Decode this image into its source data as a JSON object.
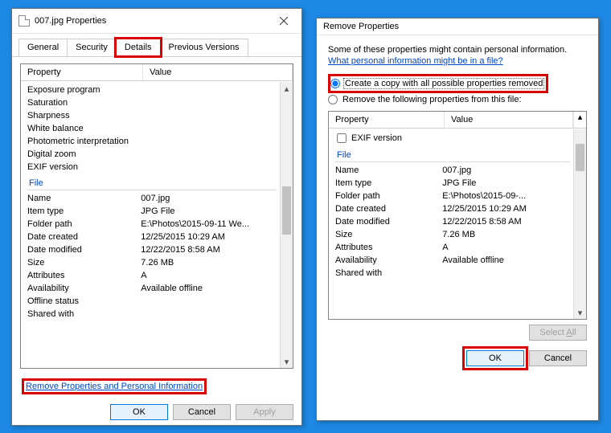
{
  "left": {
    "title": "007.jpg Properties",
    "tabs": [
      "General",
      "Security",
      "Details",
      "Previous Versions"
    ],
    "activeTab": 2,
    "columns": {
      "property": "Property",
      "value": "Value"
    },
    "groupA": [
      {
        "p": "Exposure program",
        "v": ""
      },
      {
        "p": "Saturation",
        "v": ""
      },
      {
        "p": "Sharpness",
        "v": ""
      },
      {
        "p": "White balance",
        "v": ""
      },
      {
        "p": "Photometric interpretation",
        "v": ""
      },
      {
        "p": "Digital zoom",
        "v": ""
      },
      {
        "p": "EXIF version",
        "v": ""
      }
    ],
    "fileSection": "File",
    "groupB": [
      {
        "p": "Name",
        "v": "007.jpg"
      },
      {
        "p": "Item type",
        "v": "JPG File"
      },
      {
        "p": "Folder path",
        "v": "E:\\Photos\\2015-09-11 We..."
      },
      {
        "p": "Date created",
        "v": "12/25/2015 10:29 AM"
      },
      {
        "p": "Date modified",
        "v": "12/22/2015 8:58 AM"
      },
      {
        "p": "Size",
        "v": "7.26 MB"
      },
      {
        "p": "Attributes",
        "v": "A"
      },
      {
        "p": "Availability",
        "v": "Available offline"
      },
      {
        "p": "Offline status",
        "v": ""
      },
      {
        "p": "Shared with",
        "v": ""
      }
    ],
    "removeLink": "Remove Properties and Personal Information",
    "buttons": {
      "ok": "OK",
      "cancel": "Cancel",
      "apply": "Apply"
    }
  },
  "right": {
    "title": "Remove Properties",
    "hint": "Some of these properties might contain personal information.",
    "whatLink": "What personal information might be in a file?",
    "radio1": "Create a copy with all possible properties removed",
    "radio2": "Remove the following properties from this file:",
    "columns": {
      "property": "Property",
      "value": "Value"
    },
    "exifRow": "EXIF version",
    "fileSection": "File",
    "rows": [
      {
        "p": "Name",
        "v": "007.jpg"
      },
      {
        "p": "Item type",
        "v": "JPG File"
      },
      {
        "p": "Folder path",
        "v": "E:\\Photos\\2015-09-..."
      },
      {
        "p": "Date created",
        "v": "12/25/2015 10:29 AM"
      },
      {
        "p": "Date modified",
        "v": "12/22/2015 8:58 AM"
      },
      {
        "p": "Size",
        "v": "7.26 MB"
      },
      {
        "p": "Attributes",
        "v": "A"
      },
      {
        "p": "Availability",
        "v": "Available offline"
      },
      {
        "p": "Shared with",
        "v": ""
      }
    ],
    "selectAll": "Select All",
    "selectAllHotkey": "A",
    "buttons": {
      "ok": "OK",
      "cancel": "Cancel"
    }
  }
}
